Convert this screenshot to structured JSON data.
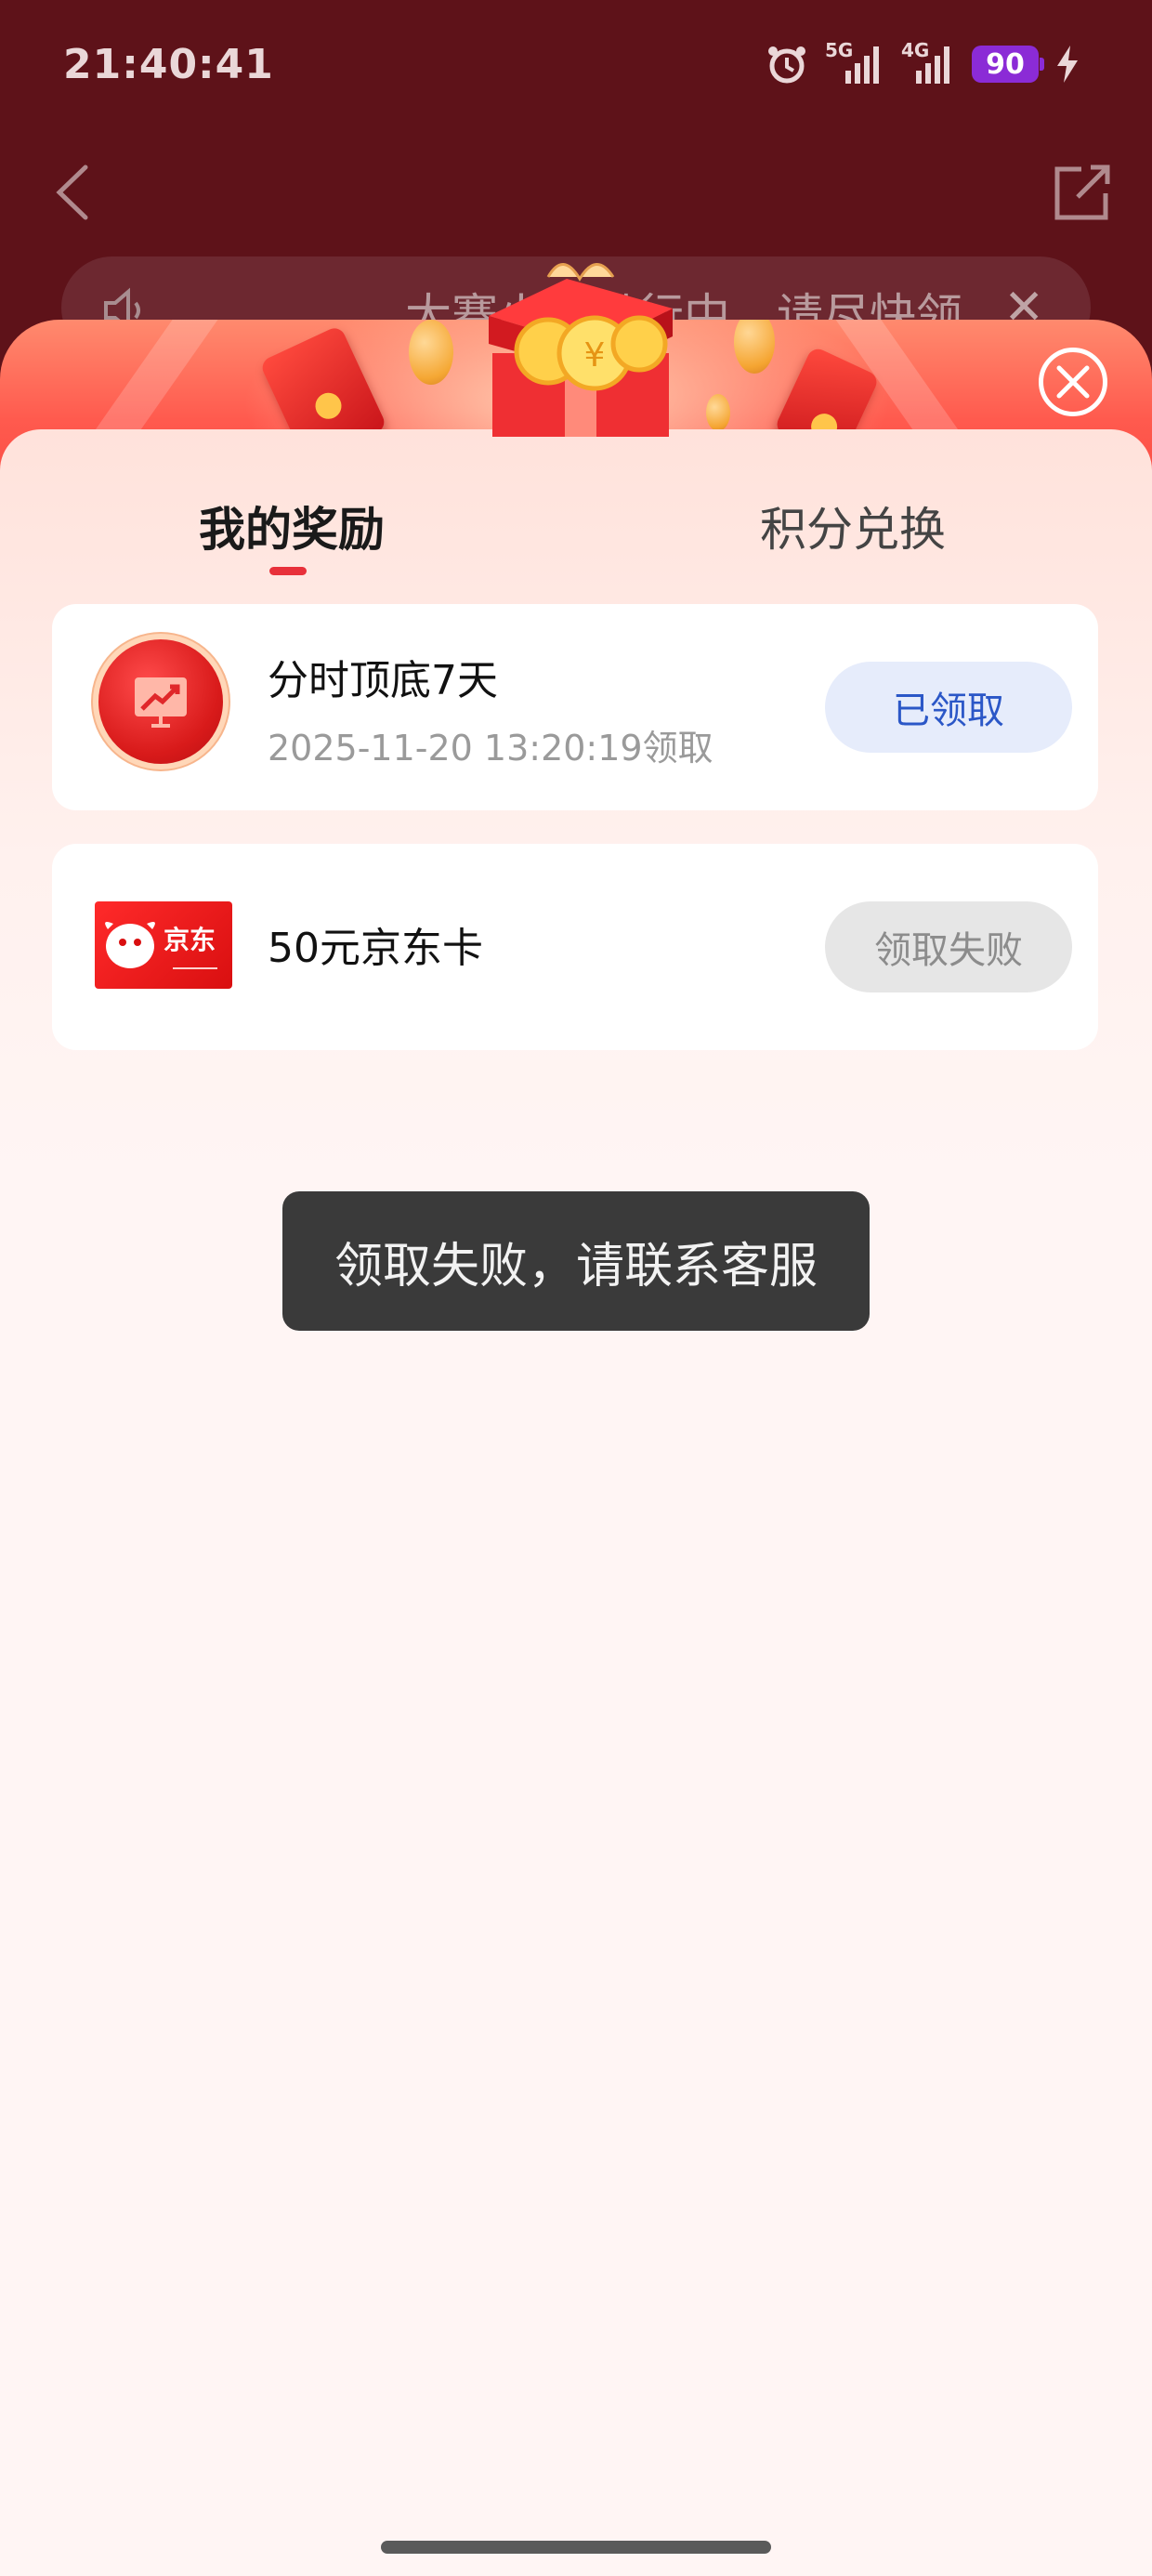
{
  "status_bar": {
    "time": "21:40:41",
    "network_1": "5G",
    "network_2": "4G",
    "battery": "90",
    "icons": [
      "alarm-icon",
      "signal-5g-icon",
      "signal-4g-icon",
      "battery-icon",
      "charging-icon"
    ]
  },
  "background_page": {
    "notice_text": "大赛火热进行中，请尽快领",
    "icons": [
      "back-icon",
      "share-icon",
      "speaker-icon",
      "close-icon"
    ]
  },
  "tabs": [
    {
      "label": "我的奖励",
      "active": true
    },
    {
      "label": "积分兑换",
      "active": false
    }
  ],
  "rewards": [
    {
      "title": "分时顶底7天",
      "subtitle": "2025-11-20 13:20:19领取",
      "button_label": "已领取",
      "icon": "chart-trend-icon"
    },
    {
      "title": "50元京东卡",
      "subtitle": "",
      "button_label": "领取失败",
      "icon": "jd-card-icon",
      "icon_text": "京东"
    }
  ],
  "toast": {
    "message": "领取失败，请联系客服"
  },
  "colors": {
    "accent_red": "#e8303a",
    "claimed_blue": "#2b57c7",
    "toast_bg": "#3a3a3a"
  }
}
